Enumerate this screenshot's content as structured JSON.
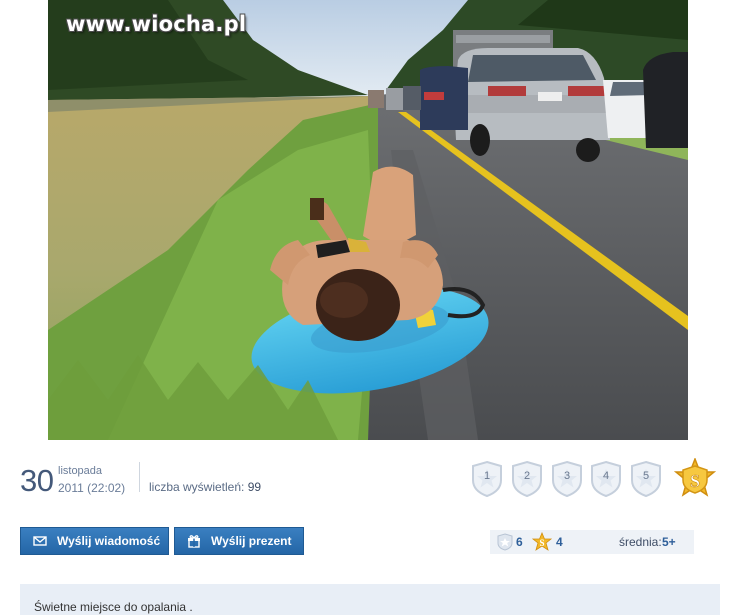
{
  "watermark": "www.wiocha.pl",
  "photo": {
    "subject": "woman sunbathing on inflatable ring by highway traffic jam"
  },
  "date": {
    "day": "30",
    "month": "listopada",
    "year_time": "2011 (22:02)"
  },
  "views": {
    "label": "liczba wyświetleń:",
    "count": "99"
  },
  "rating": {
    "stars": [
      "1",
      "2",
      "3",
      "4",
      "5"
    ],
    "super_label": "S"
  },
  "buttons": {
    "send_message": "Wyślij wiadomość",
    "send_gift": "Wyślij prezent"
  },
  "summary": {
    "star_votes": "6",
    "super_votes": "4",
    "average_label": "średnia:",
    "average_value": "5+"
  },
  "description": "Świetne miejsce do opalania .",
  "colors": {
    "button": "#2c6fb0",
    "accent_text": "#2e5f9a",
    "panel": "#e8eef6"
  }
}
